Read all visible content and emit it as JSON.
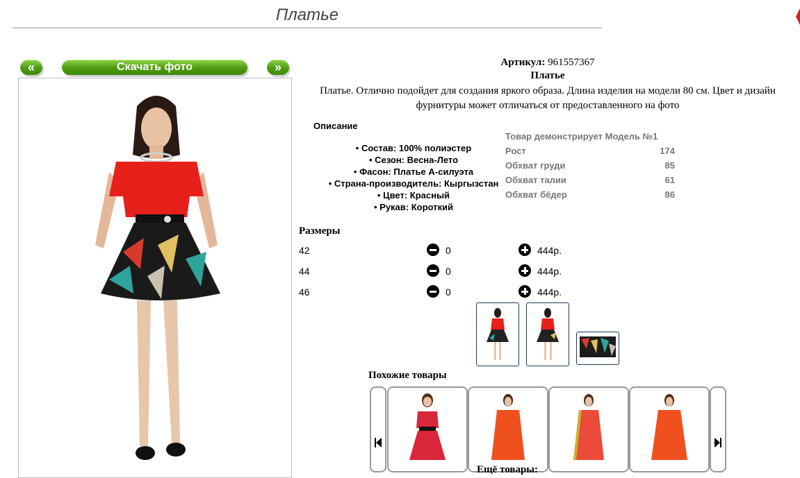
{
  "header": {
    "title": "Платье"
  },
  "photo_nav": {
    "prev_label": "«",
    "download_label": "Скачать фото",
    "next_label": "»"
  },
  "product": {
    "article_label": "Артикул:",
    "article_value": "961557367",
    "name": "Платье",
    "description": "Платье. Отлично подойдет для создания яркого образа. Длина изделия на модели 80 см. Цвет и дизайн фурнитуры может отличаться от предоставленного на фото"
  },
  "description_section": {
    "heading": "Описание",
    "specs": [
      "• Состав: 100% полиэстер",
      "• Сезон: Весна-Лето",
      "• Фасон: Платье А-силуэта",
      "• Страна-производитель: Кыргызстан",
      "• Цвет: Красный",
      "• Рукав: Короткий"
    ]
  },
  "model_info": {
    "title": "Товар демонстрирует Модель №1",
    "rows": [
      {
        "label": "Рост",
        "value": "174"
      },
      {
        "label": "Обхват груди",
        "value": "85"
      },
      {
        "label": "Обхват талии",
        "value": "61"
      },
      {
        "label": "Обхват бёдер",
        "value": "86"
      }
    ]
  },
  "sizes": {
    "heading": "Размеры",
    "rows": [
      {
        "size": "42",
        "qty": "0",
        "price": "444р."
      },
      {
        "size": "44",
        "qty": "0",
        "price": "444р."
      },
      {
        "size": "46",
        "qty": "0",
        "price": "444р."
      }
    ]
  },
  "similar": {
    "heading": "Похожие товары"
  },
  "more": {
    "heading": "Ещё товары:"
  },
  "colors": {
    "accent_green": "#4f9a12",
    "thumb_border": "#1e3a5c",
    "dress_red": "#e8201c"
  }
}
